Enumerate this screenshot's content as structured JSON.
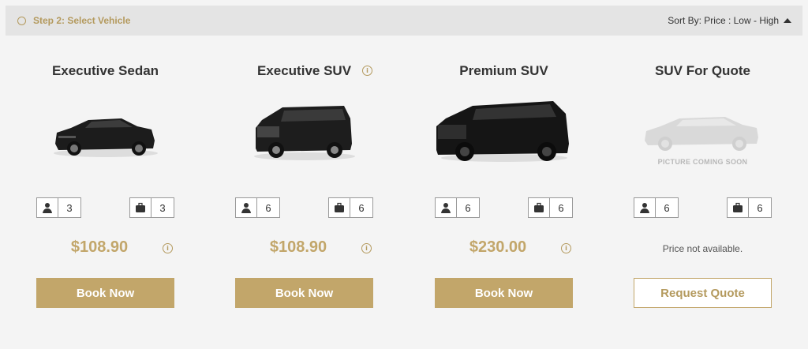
{
  "step": {
    "title": "Step 2: Select Vehicle"
  },
  "sort": {
    "label": "Sort By: Price : Low - High"
  },
  "colors": {
    "accent": "#c2a66a",
    "accent_dark": "#b49a5e"
  },
  "vehicles": [
    {
      "name": "Executive Sedan",
      "passengers": "3",
      "luggage": "3",
      "price": "$108.90",
      "button": "Book Now"
    },
    {
      "name": "Executive SUV",
      "passengers": "6",
      "luggage": "6",
      "price": "$108.90",
      "button": "Book Now"
    },
    {
      "name": "Premium SUV",
      "passengers": "6",
      "luggage": "6",
      "price": "$230.00",
      "button": "Book Now"
    },
    {
      "name": "SUV For Quote",
      "passengers": "6",
      "luggage": "6",
      "price_note": "Price not available.",
      "image_note": "PICTURE COMING SOON",
      "button": "Request Quote"
    }
  ]
}
